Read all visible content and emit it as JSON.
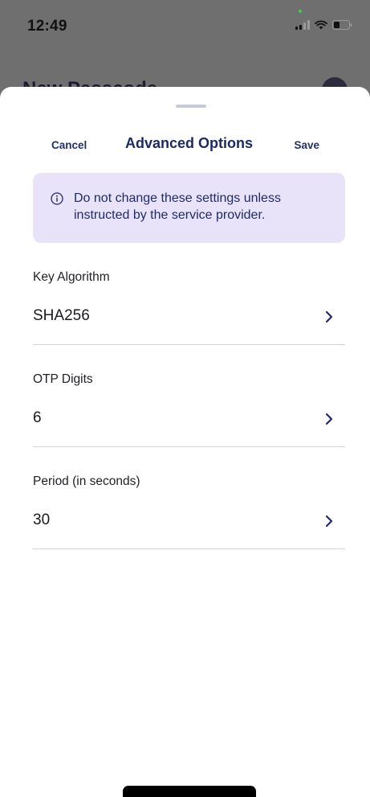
{
  "status_bar": {
    "time": "12:49"
  },
  "background_page": {
    "title": "New Passcode"
  },
  "header": {
    "cancel_label": "Cancel",
    "title": "Advanced Options",
    "save_label": "Save"
  },
  "notice": {
    "icon": "info-icon",
    "text": "Do not change these settings unless instructed by the service provider."
  },
  "fields": [
    {
      "label": "Key Algorithm",
      "value": "SHA256"
    },
    {
      "label": "OTP Digits",
      "value": "6"
    },
    {
      "label": "Period (in seconds)",
      "value": "30"
    }
  ],
  "colors": {
    "accent": "#1d2a66",
    "notice_bg": "#e9e3fa",
    "overlay": "#6f6f6f"
  }
}
